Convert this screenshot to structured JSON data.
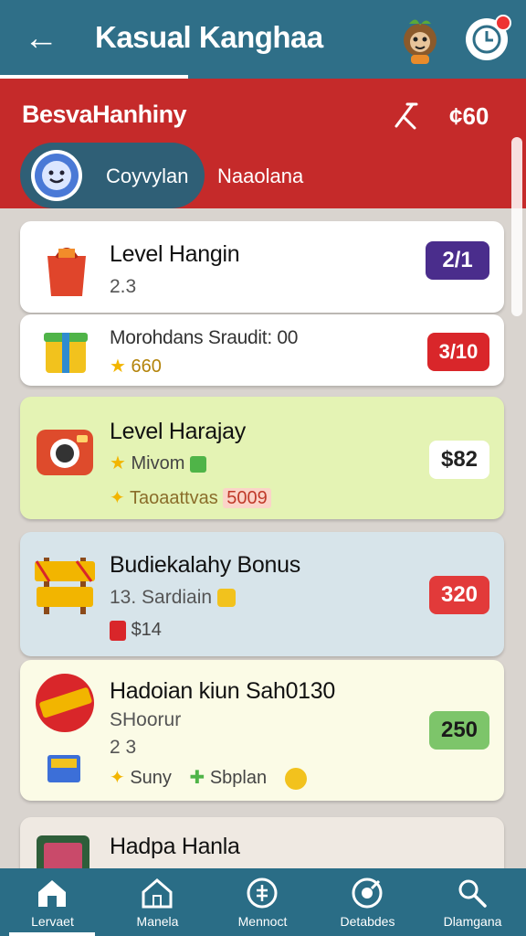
{
  "appbar": {
    "title": "Kasual Kanghaa",
    "back_icon": "arrow-left-icon",
    "avatar_icon": "monkey-avatar-icon",
    "clock_icon": "clock-icon"
  },
  "header": {
    "subtitle": "BesvaHanhiny",
    "pin_icon": "pin-icon",
    "count": "¢60",
    "chip_label": "Coyvylan",
    "tab_label": "Naaolana"
  },
  "cards": [
    {
      "title": "Level Hangin",
      "sub": "2.3",
      "badge": "2/1",
      "badge_color": "#4a2d8c",
      "icon": "shopping-bag-icon"
    },
    {
      "title": "Morohdans Sraudit: 00",
      "meta": "660",
      "badge": "3/10",
      "badge_color": "#d9262a",
      "icon": "gift-box-icon"
    },
    {
      "title": "Level Harajay",
      "meta1": "Mivom",
      "meta2": "Taoaattvas",
      "meta2_value": "5009",
      "badge": "$82",
      "badge_color": "#ffffff",
      "icon": "camera-icon"
    },
    {
      "title": "Budiekalahy Bonus",
      "sub": "13. Sardiain",
      "meta": "$14",
      "badge": "320",
      "badge_color": "#e23a3a",
      "icon": "sign-icon"
    },
    {
      "title": "Hadoian kiun Sah0130",
      "sub": "SHoorur",
      "sub2": "2 3",
      "meta1": "Suny",
      "meta2": "Sbplan",
      "badge": "250",
      "badge_color": "#7dc56a",
      "icon": "sale-badge-icon"
    },
    {
      "title": "Hadpa Hanla",
      "icon": "phone-icon"
    }
  ],
  "nav": [
    {
      "label": "Lervaet",
      "icon": "home-icon"
    },
    {
      "label": "Manela",
      "icon": "house-icon"
    },
    {
      "label": "Mennoct",
      "icon": "coin-icon"
    },
    {
      "label": "Detabdes",
      "icon": "target-icon"
    },
    {
      "label": "Dlamgana",
      "icon": "search-icon"
    }
  ]
}
